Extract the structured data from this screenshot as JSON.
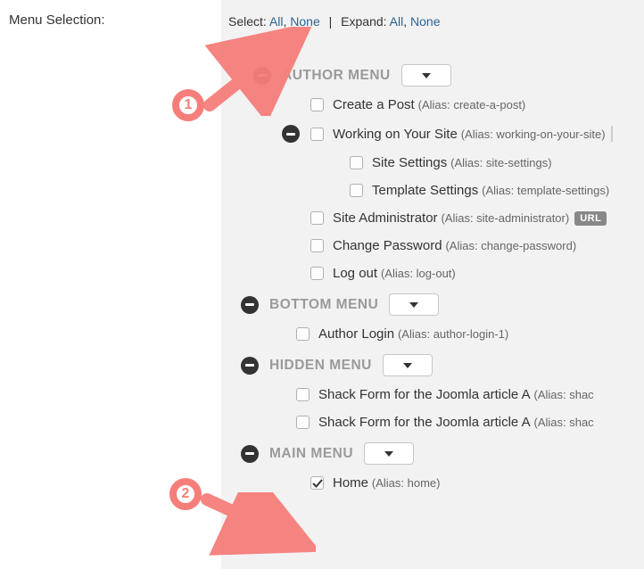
{
  "left_label": "Menu Selection:",
  "top": {
    "select_label": "Select:",
    "select_all": "All",
    "select_none": "None",
    "expand_label": "Expand:",
    "expand_all": "All",
    "expand_none": "None"
  },
  "author_menu": {
    "title": "AUTHOR MENU",
    "items": [
      {
        "label": "Create a Post",
        "alias": "(Alias: create-a-post)"
      },
      {
        "label": "Working on Your Site",
        "alias": "(Alias: working-on-your-site)"
      },
      {
        "label": "Site Settings",
        "alias": "(Alias: site-settings)"
      },
      {
        "label": "Template Settings",
        "alias": "(Alias: template-settings)"
      },
      {
        "label": "Site Administrator",
        "alias": "(Alias: site-administrator)",
        "badge": "URL"
      },
      {
        "label": "Change Password",
        "alias": "(Alias: change-password)"
      },
      {
        "label": "Log out",
        "alias": "(Alias: log-out)"
      }
    ]
  },
  "bottom_menu": {
    "title": "BOTTOM MENU",
    "items": [
      {
        "label": "Author Login",
        "alias": "(Alias: author-login-1)"
      }
    ]
  },
  "hidden_menu": {
    "title": "HIDDEN MENU",
    "items": [
      {
        "label": "Shack Form for the Joomla article A",
        "alias": "(Alias: shac"
      },
      {
        "label": "Shack Form for the Joomla article A",
        "alias": "(Alias: shac"
      }
    ]
  },
  "main_menu": {
    "title": "MAIN MENU",
    "items": [
      {
        "label": "Home",
        "alias": "(Alias: home)",
        "checked": true
      }
    ]
  },
  "annotations": {
    "marker1": "1",
    "marker2": "2"
  }
}
